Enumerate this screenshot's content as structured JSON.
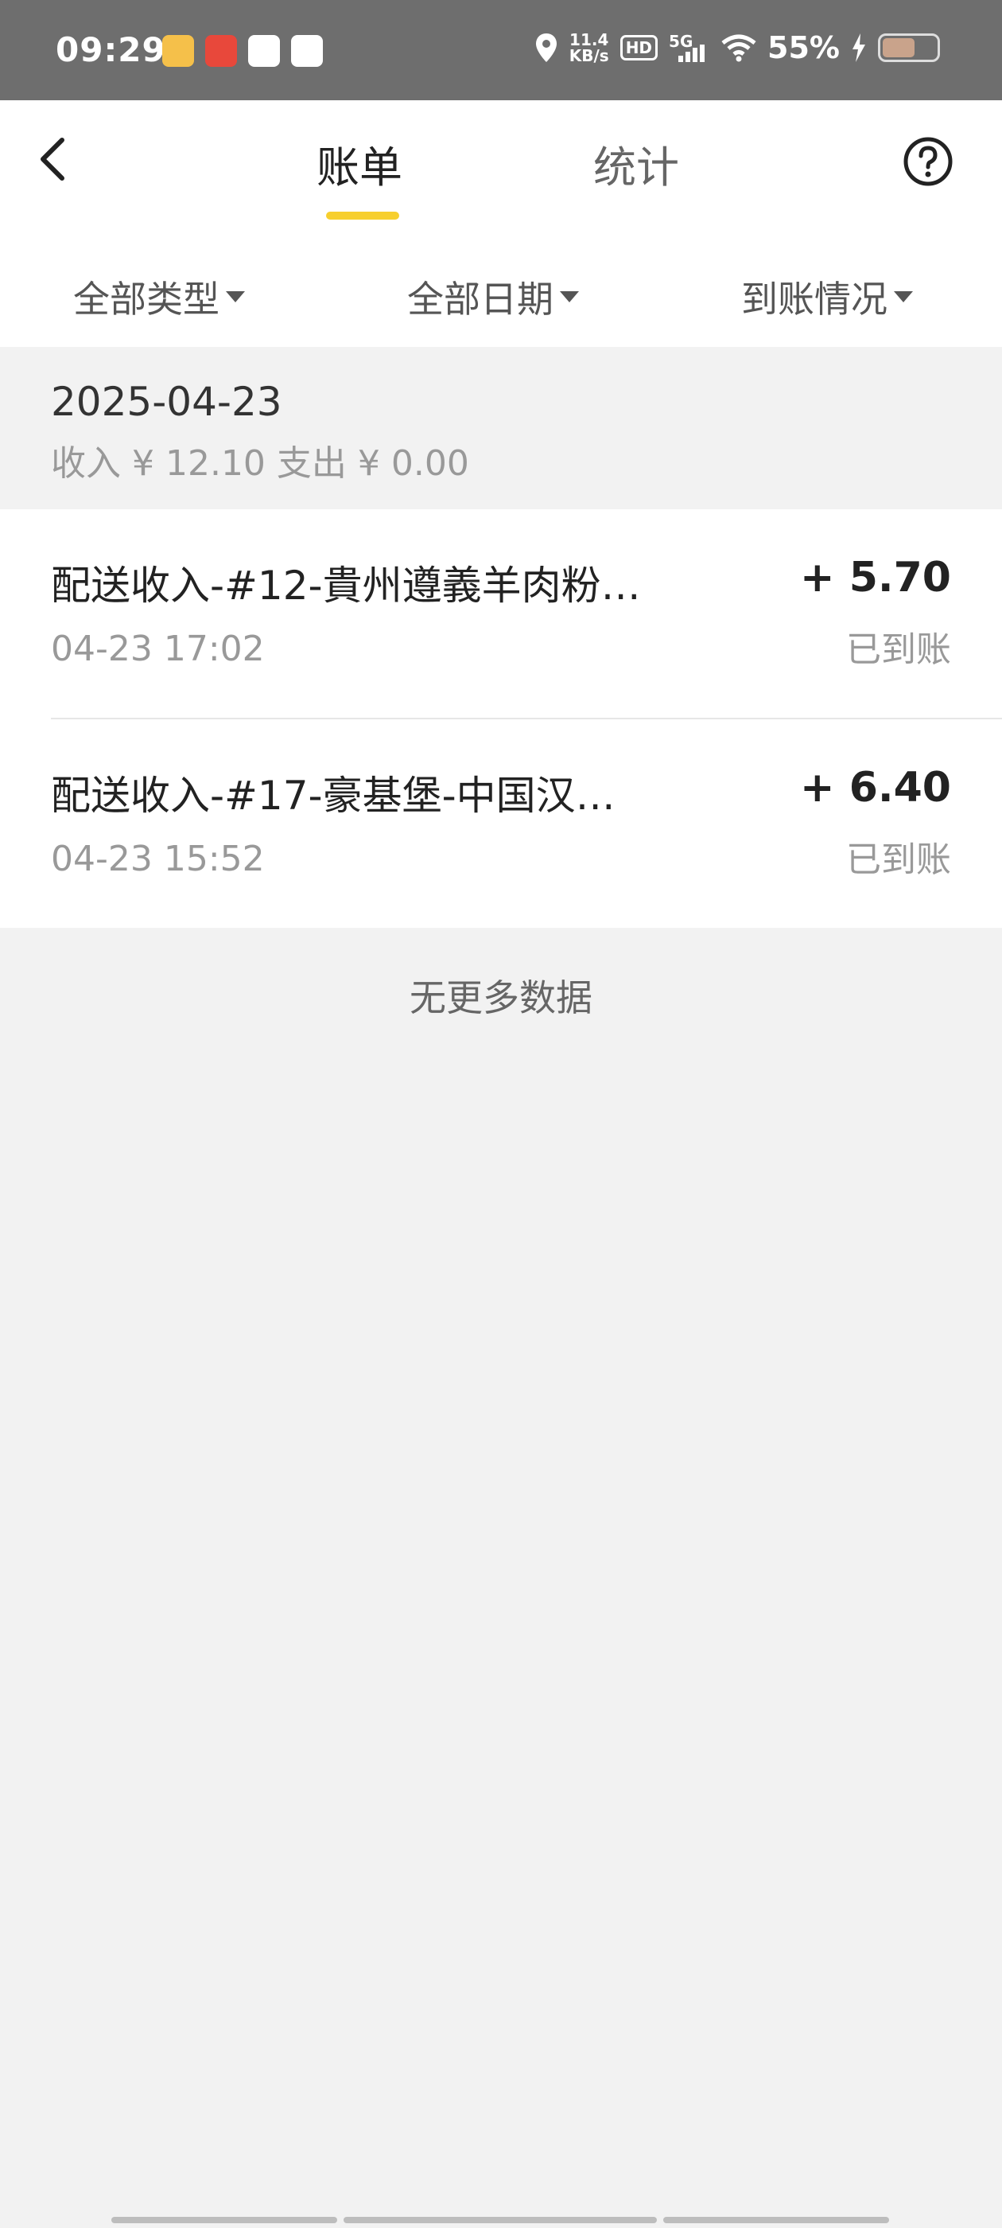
{
  "status_bar": {
    "time": "09:29",
    "speed_value": "11.4",
    "speed_unit": "KB/s",
    "hd": "HD",
    "network": "5G",
    "battery": "55%",
    "app_icons": [
      "#f5c04a",
      "#e8483b",
      "#ffffff",
      "#ffffff"
    ]
  },
  "header": {
    "tabs": [
      {
        "label": "账单",
        "active": true
      },
      {
        "label": "统计",
        "active": false
      }
    ],
    "accent_color": "#f7cf2e"
  },
  "filters": [
    {
      "label": "全部类型"
    },
    {
      "label": "全部日期"
    },
    {
      "label": "到账情况"
    }
  ],
  "group": {
    "date": "2025-04-23",
    "summary": "收入 ¥ 12.10 支出 ¥ 0.00"
  },
  "records": [
    {
      "title": "配送收入-#12-貴州遵義羊肉粉…",
      "time": "04-23 17:02",
      "amount": "+ 5.70",
      "status": "已到账"
    },
    {
      "title": "配送收入-#17-豪基堡-中国汉…",
      "time": "04-23 15:52",
      "amount": "+ 6.40",
      "status": "已到账"
    }
  ],
  "footer": {
    "no_more": "无更多数据"
  }
}
